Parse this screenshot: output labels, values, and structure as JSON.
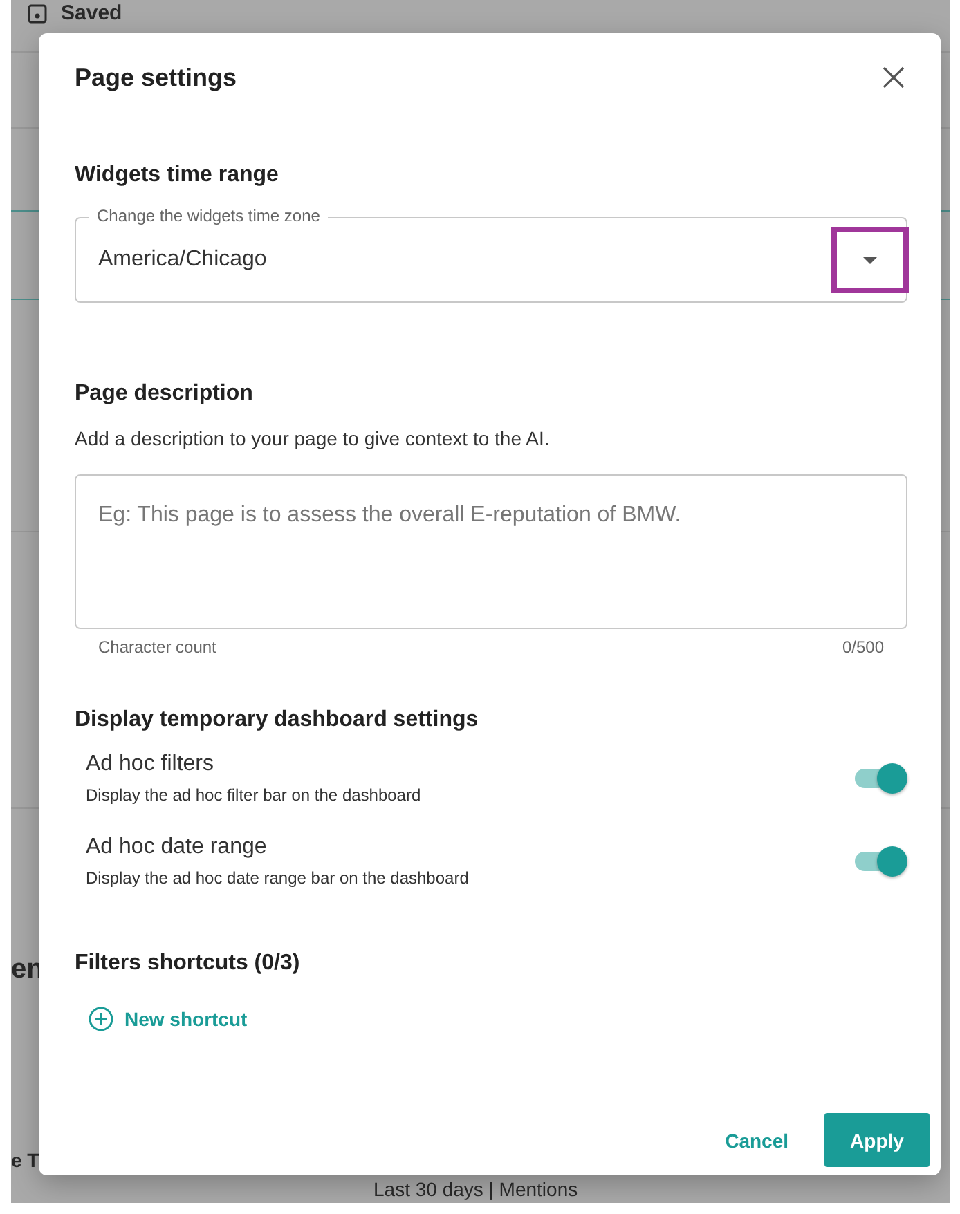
{
  "background": {
    "saved_label": "Saved",
    "texts": [
      {
        "text": "en",
        "kind": "heading"
      },
      {
        "text": "e T",
        "kind": "heading"
      },
      {
        "text": "Last 30 days | Mentions",
        "kind": "caption"
      }
    ]
  },
  "dialog": {
    "title": "Page settings",
    "time_range": {
      "heading": "Widgets time range",
      "field_label": "Change the widgets time zone",
      "value": "America/Chicago",
      "caret_highlighted": true
    },
    "description": {
      "heading": "Page description",
      "hint": "Add a description to your page to give context to the AI.",
      "placeholder": "Eg: This page is to assess the overall E-reputation of BMW.",
      "counter_label": "Character count",
      "counter": "0/500"
    },
    "display_settings": {
      "heading": "Display temporary dashboard settings",
      "toggles": [
        {
          "label": "Ad hoc filters",
          "description": "Display the ad hoc filter bar on the dashboard",
          "on": true
        },
        {
          "label": "Ad hoc date range",
          "description": "Display the ad hoc date range bar on the dashboard",
          "on": true
        }
      ]
    },
    "shortcuts": {
      "heading": "Filters shortcuts (0/3)",
      "add_button": "New shortcut"
    },
    "buttons": [
      {
        "label": "Cancel",
        "kind": "text"
      },
      {
        "label": "Apply",
        "kind": "primary"
      }
    ]
  }
}
